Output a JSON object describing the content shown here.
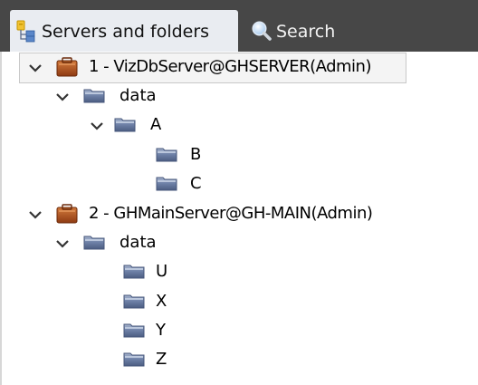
{
  "tabs": [
    {
      "label": "Servers and folders",
      "icon": "servers-folders-icon",
      "active": true
    },
    {
      "label": "Search",
      "icon": "search-icon",
      "active": false
    }
  ],
  "tree": {
    "servers": [
      {
        "label": "1 - VizDbServer@GHSERVER(Admin)",
        "expanded": true,
        "selected": true,
        "folders": [
          {
            "label": "data",
            "expanded": true,
            "children": [
              {
                "label": "A",
                "expanded": true,
                "children": [
                  {
                    "label": "B"
                  },
                  {
                    "label": "C"
                  }
                ]
              }
            ]
          }
        ]
      },
      {
        "label": "2 - GHMainServer@GH-MAIN(Admin)",
        "expanded": true,
        "selected": false,
        "folders": [
          {
            "label": "data",
            "expanded": true,
            "children": [
              {
                "label": "U"
              },
              {
                "label": "X"
              },
              {
                "label": "Y"
              },
              {
                "label": "Z"
              }
            ]
          }
        ]
      }
    ]
  },
  "colors": {
    "tab_strip": "#474747",
    "active_tab": "#e9ecf1",
    "server_icon": "#b5501a",
    "folder_icon": "#5f7196"
  }
}
